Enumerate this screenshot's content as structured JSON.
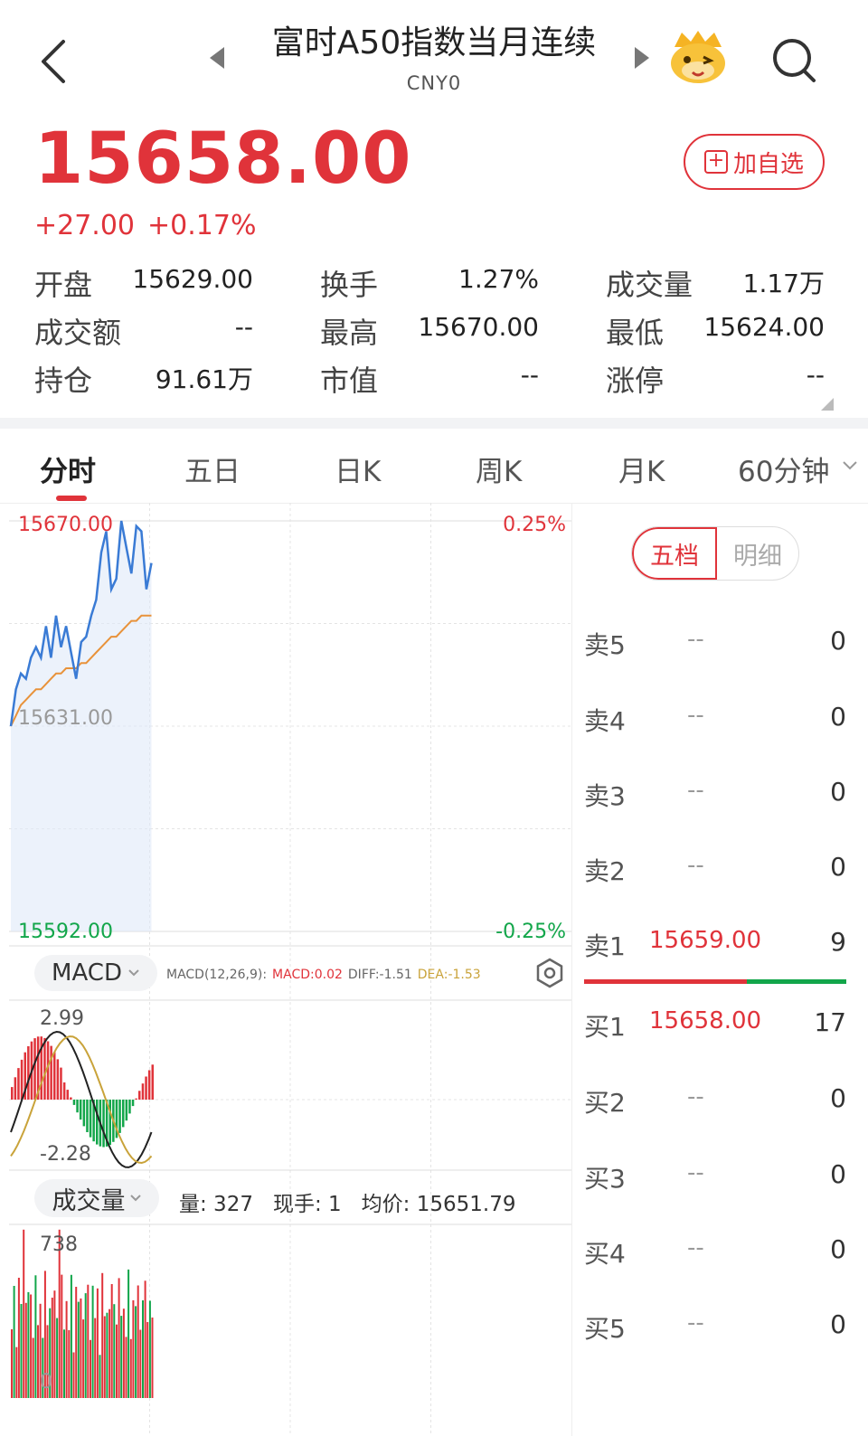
{
  "header": {
    "title": "富时A50指数当月连续",
    "code": "CNY0"
  },
  "quote": {
    "price": "15658.00",
    "change": "+27.00",
    "change_pct": "+0.17%",
    "add_label": "加自选"
  },
  "stats": {
    "open_label": "开盘",
    "open_value": "15629.00",
    "turnover_label": "换手",
    "turnover_value": "1.27%",
    "volume_label": "成交量",
    "volume_value": "1.17万",
    "amount_label": "成交额",
    "amount_value": "--",
    "high_label": "最高",
    "high_value": "15670.00",
    "low_label": "最低",
    "low_value": "15624.00",
    "oi_label": "持仓",
    "oi_value": "91.61万",
    "mcap_label": "市值",
    "mcap_value": "--",
    "limitup_label": "涨停",
    "limitup_value": "--"
  },
  "tabs": [
    "分时",
    "五日",
    "日K",
    "周K",
    "月K",
    "60分钟"
  ],
  "chart": {
    "price_top": "15670.00",
    "price_mid": "15631.00",
    "price_bottom": "15592.00",
    "pct_top": "0.25%",
    "pct_bottom": "-0.25%",
    "macd_label": "MACD",
    "macd_params": "MACD(12,26,9):",
    "macd_value": "MACD:0.02",
    "diff_value": "DIFF:-1.51",
    "dea_value": "DEA:-1.53",
    "macd_max": "2.99",
    "macd_min": "-2.28",
    "vol_label": "成交量",
    "vol_qty": "量: 327",
    "vol_hand": "现手: 1",
    "vol_avg": "均价: 15651.79",
    "vol_max": "738",
    "vol_zero": "0",
    "colors": {
      "up": "#e0333a",
      "down": "#12a64a",
      "price_line": "#3a7bd5",
      "avg_line": "#e8923a"
    }
  },
  "chart_data": {
    "type": "line",
    "series": [
      {
        "values": [
          15631,
          15638,
          15641,
          15640,
          15644,
          15646,
          15644,
          15650,
          15644,
          15652,
          15646,
          15650,
          15645,
          15640,
          15647,
          15648,
          15652,
          15655,
          15664,
          15668,
          15657,
          15659,
          15670,
          15665,
          15660,
          15669,
          15668,
          15657,
          15662
        ]
      },
      {
        "values": [
          15631,
          15633,
          15635,
          15636,
          15637,
          15638,
          15638,
          15639,
          15640,
          15641,
          15641,
          15642,
          15642,
          15642,
          15643,
          15643,
          15644,
          15645,
          15646,
          15647,
          15648,
          15648,
          15649,
          15650,
          15651,
          15651,
          15652,
          15652,
          15652
        ]
      }
    ],
    "ylim": [
      15592,
      15670
    ]
  },
  "orderbook": {
    "tab_active": "五档",
    "tab_inactive": "明细",
    "asks": [
      {
        "name": "卖5",
        "price": "--",
        "qty": "0"
      },
      {
        "name": "卖4",
        "price": "--",
        "qty": "0"
      },
      {
        "name": "卖3",
        "price": "--",
        "qty": "0"
      },
      {
        "name": "卖2",
        "price": "--",
        "qty": "0"
      },
      {
        "name": "卖1",
        "price": "15659.00",
        "qty": "9"
      }
    ],
    "bids": [
      {
        "name": "买1",
        "price": "15658.00",
        "qty": "17"
      },
      {
        "name": "买2",
        "price": "--",
        "qty": "0"
      },
      {
        "name": "买3",
        "price": "--",
        "qty": "0"
      },
      {
        "name": "买4",
        "price": "--",
        "qty": "0"
      },
      {
        "name": "买5",
        "price": "--",
        "qty": "0"
      }
    ]
  }
}
